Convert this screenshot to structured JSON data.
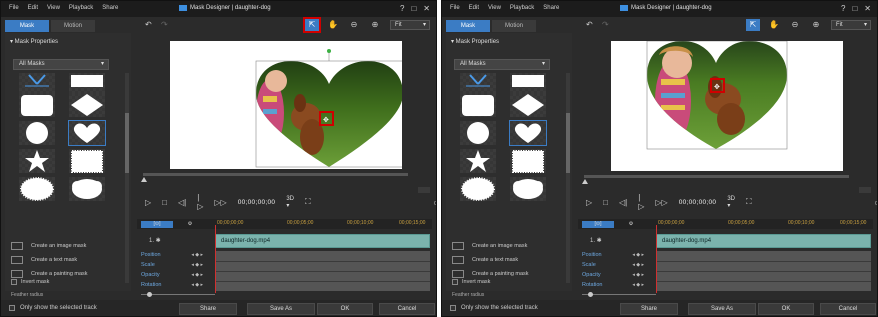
{
  "menu": [
    "File",
    "Edit",
    "View",
    "Playback",
    "Share"
  ],
  "window_title": "Mask Designer | daughter-dog",
  "window_buttons": [
    "?",
    "□",
    "✕"
  ],
  "tabs": [
    "Mask",
    "Motion"
  ],
  "panel_title": "▾ Mask Properties",
  "masks_dropdown": "All Masks",
  "mask_options": [
    "Create an image mask",
    "Create a text mask",
    "Create a painting mask"
  ],
  "invert_label": "Invert mask",
  "feather_label": "Feather radius",
  "toolbar": {
    "undo": "↶",
    "redo": "↷",
    "fit": "Fit"
  },
  "controls": {
    "timecode": "00;00;00;00",
    "three_d": "3D ▾"
  },
  "timeline": {
    "ticks": [
      "00;00;00;00",
      "00;00;05;00",
      "00;00;10;00",
      "00;00;15;00"
    ],
    "track_label": "1. ✱",
    "clip_label": "daughter-dog.mp4",
    "properties": [
      "Position",
      "Scale",
      "Opacity",
      "Rotation"
    ]
  },
  "bottom": {
    "only_selected": "Only show the selected track",
    "share": "Share",
    "save_as": "Save As",
    "ok": "OK",
    "cancel": "Cancel"
  },
  "colors": {
    "accent": "#3b7cc4",
    "clip": "#7bb3ad",
    "highlight": "#d00000"
  }
}
